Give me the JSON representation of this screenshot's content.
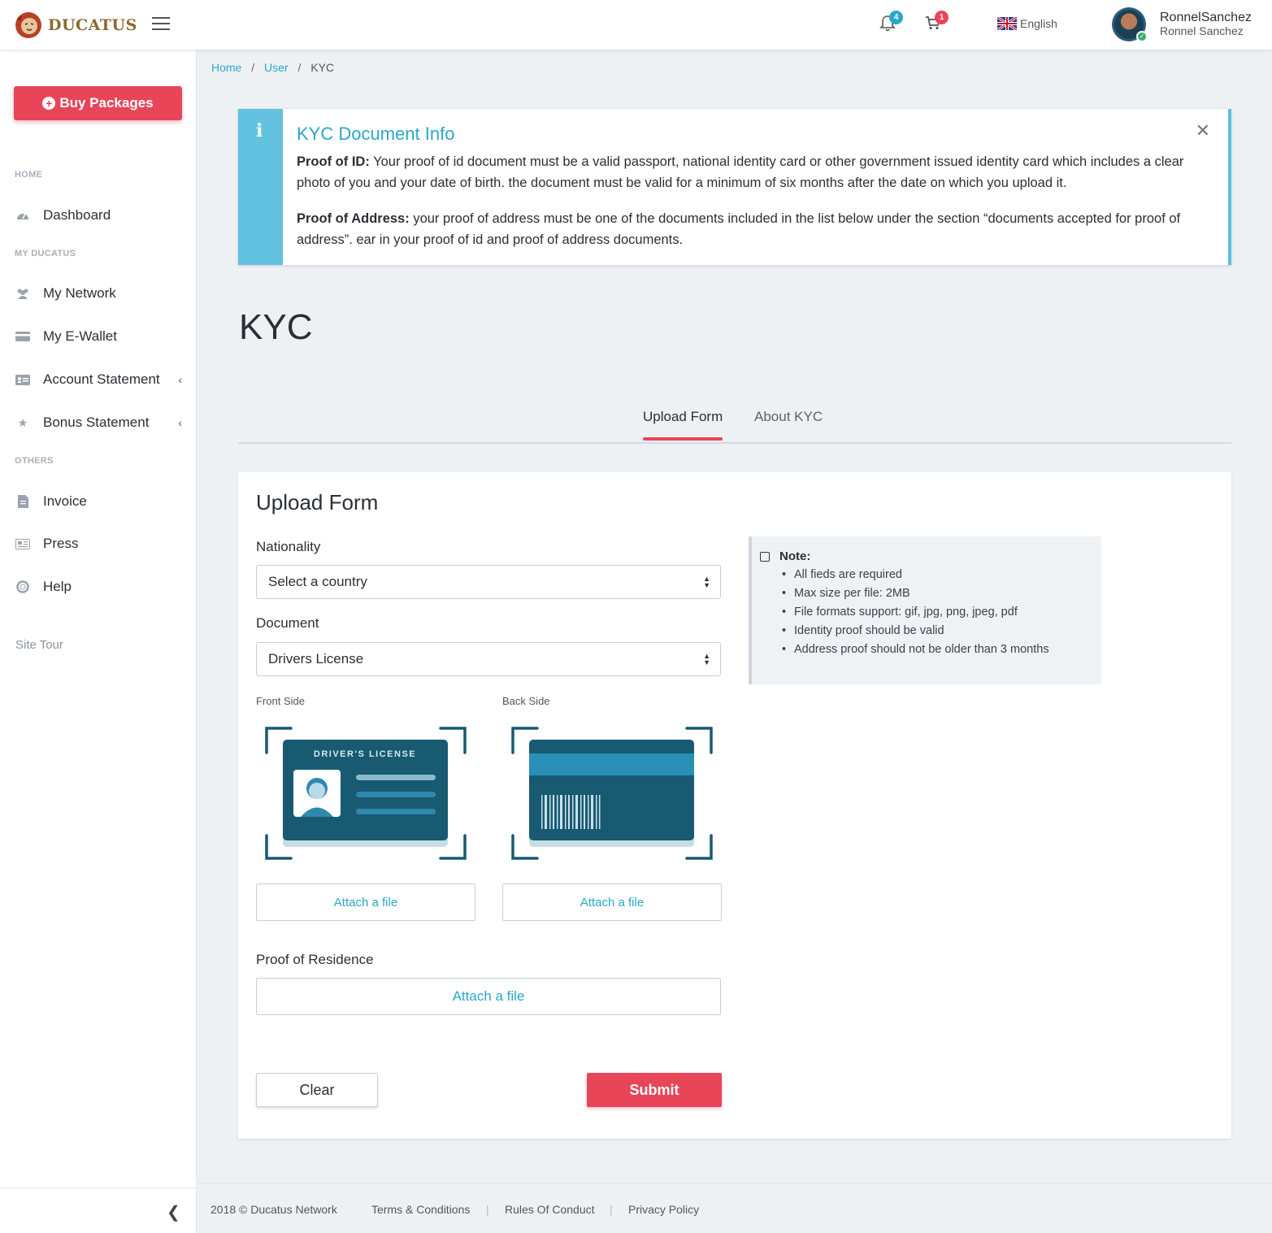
{
  "brand": {
    "name": "DUCATUS"
  },
  "header": {
    "notifications_count": "4",
    "cart_count": "1",
    "language": "English",
    "user_name": "RonnelSanchez",
    "user_fullname": "Ronnel Sanchez"
  },
  "sidebar": {
    "buy_label": "Buy Packages",
    "sections": {
      "home": "HOME",
      "my": "MY DUCATUS",
      "others": "OTHERS"
    },
    "items": {
      "dashboard": "Dashboard",
      "network": "My Network",
      "ewallet": "My E-Wallet",
      "account": "Account Statement",
      "bonus": "Bonus Statement",
      "invoice": "Invoice",
      "press": "Press",
      "help": "Help"
    },
    "site_tour": "Site Tour"
  },
  "breadcrumb": {
    "home": "Home",
    "user": "User",
    "current": "KYC",
    "sep": "/"
  },
  "alert": {
    "title": "KYC Document Info",
    "id_label": "Proof of ID:",
    "id_text": " Your proof of id document must be a valid passport, national identity card or other government issued identity card which includes a clear photo of you and your date of birth. the document must be valid for a minimum of six months after the date on which you upload it.",
    "addr_label": "Proof of Address:",
    "addr_text": " your proof of address must be one of the documents included in the list below under the section “documents accepted for proof of address”. ear in your proof of id and proof of address documents."
  },
  "page": {
    "title": "KYC"
  },
  "tabs": {
    "upload": "Upload Form",
    "about": "About KYC"
  },
  "form": {
    "title": "Upload Form",
    "nationality_label": "Nationality",
    "nationality_value": "Select a country",
    "document_label": "Document",
    "document_value": "Drivers License",
    "front_label": "Front Side",
    "back_label": "Back Side",
    "license_text": "DRIVER'S LICENSE",
    "attach_label": "Attach a file",
    "residence_label": "Proof of Residence",
    "clear_label": "Clear",
    "submit_label": "Submit"
  },
  "note": {
    "title": "Note:",
    "items": [
      "All fieds are required",
      "Max size per file: 2MB",
      "File formats support: gif, jpg, png, jpeg, pdf",
      "Identity proof should be valid",
      "Address proof should not be older than 3 months"
    ]
  },
  "footer": {
    "copyright": "2018 © Ducatus Network",
    "terms": "Terms & Conditions",
    "rules": "Rules Of Conduct",
    "privacy": "Privacy Policy"
  },
  "colors": {
    "accent": "#e84559",
    "link": "#2aa7c9",
    "info": "#62c2df",
    "card_dark": "#175a72"
  }
}
